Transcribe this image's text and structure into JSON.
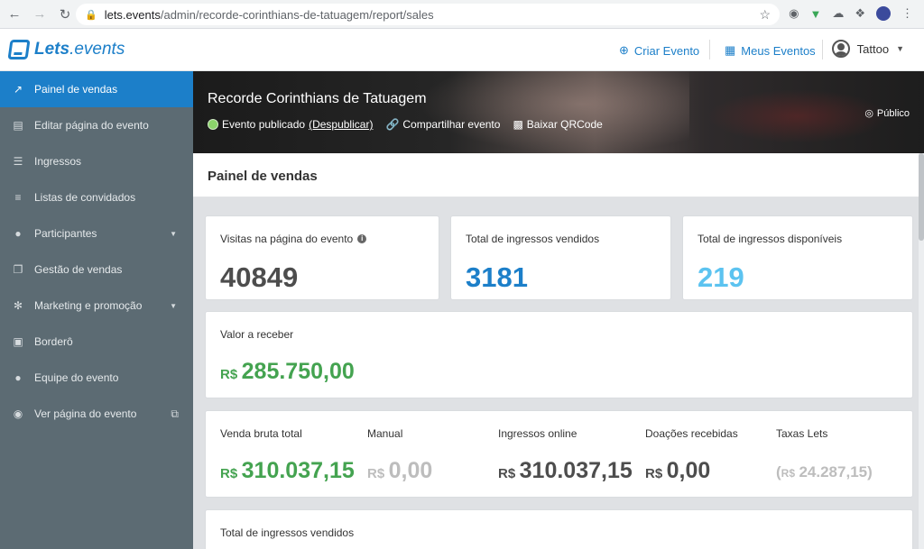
{
  "browser": {
    "host": "lets.events",
    "path": "/admin/recorde-corinthians-de-tatuagem/report/sales"
  },
  "header": {
    "logo_bold": "Lets",
    "logo_light": ".events",
    "create_event": "Criar Evento",
    "my_events": "Meus Eventos",
    "user_name": "Tattoo"
  },
  "sidebar": {
    "items": [
      {
        "label": "Painel de vendas",
        "icon": "chart-line-icon"
      },
      {
        "label": "Editar página do evento",
        "icon": "edit-window-icon"
      },
      {
        "label": "Ingressos",
        "icon": "barcode-icon"
      },
      {
        "label": "Listas de convidados",
        "icon": "list-icon"
      },
      {
        "label": "Participantes",
        "icon": "users-icon"
      },
      {
        "label": "Gestão de vendas",
        "icon": "windows-icon"
      },
      {
        "label": "Marketing e promoção",
        "icon": "broadcast-icon"
      },
      {
        "label": "Borderô",
        "icon": "receipt-icon"
      },
      {
        "label": "Equipe do evento",
        "icon": "team-icon"
      },
      {
        "label": "Ver página do evento",
        "icon": "eye-icon"
      }
    ]
  },
  "event": {
    "title": "Recorde Corinthians de Tatuagem",
    "status": "Evento publicado",
    "unpublish": "(Despublicar)",
    "share": "Compartilhar evento",
    "qrcode": "Baixar QRCode",
    "visibility": "Público"
  },
  "page": {
    "title": "Painel de vendas"
  },
  "stats": {
    "visits_label": "Visitas na página do evento",
    "visits_value": "40849",
    "sold_label": "Total de ingressos vendidos",
    "sold_value": "3181",
    "available_label": "Total de ingressos disponíveis",
    "available_value": "219",
    "receivable_label": "Valor a receber",
    "receivable_currency": "R$",
    "receivable_value": "285.750,00"
  },
  "revenue": {
    "gross_label": "Venda bruta total",
    "gross_currency": "R$",
    "gross_value": "310.037,15",
    "manual_label": "Manual",
    "manual_currency": "R$",
    "manual_value": "0,00",
    "online_label": "Ingressos online",
    "online_currency": "R$",
    "online_value": "310.037,15",
    "donations_label": "Doações recebidas",
    "donations_currency": "R$",
    "donations_value": "0,00",
    "fees_label": "Taxas Lets",
    "fees_open": "(",
    "fees_currency": "R$",
    "fees_value": "24.287,15)"
  },
  "tickets_section": {
    "title": "Total de ingressos vendidos"
  }
}
